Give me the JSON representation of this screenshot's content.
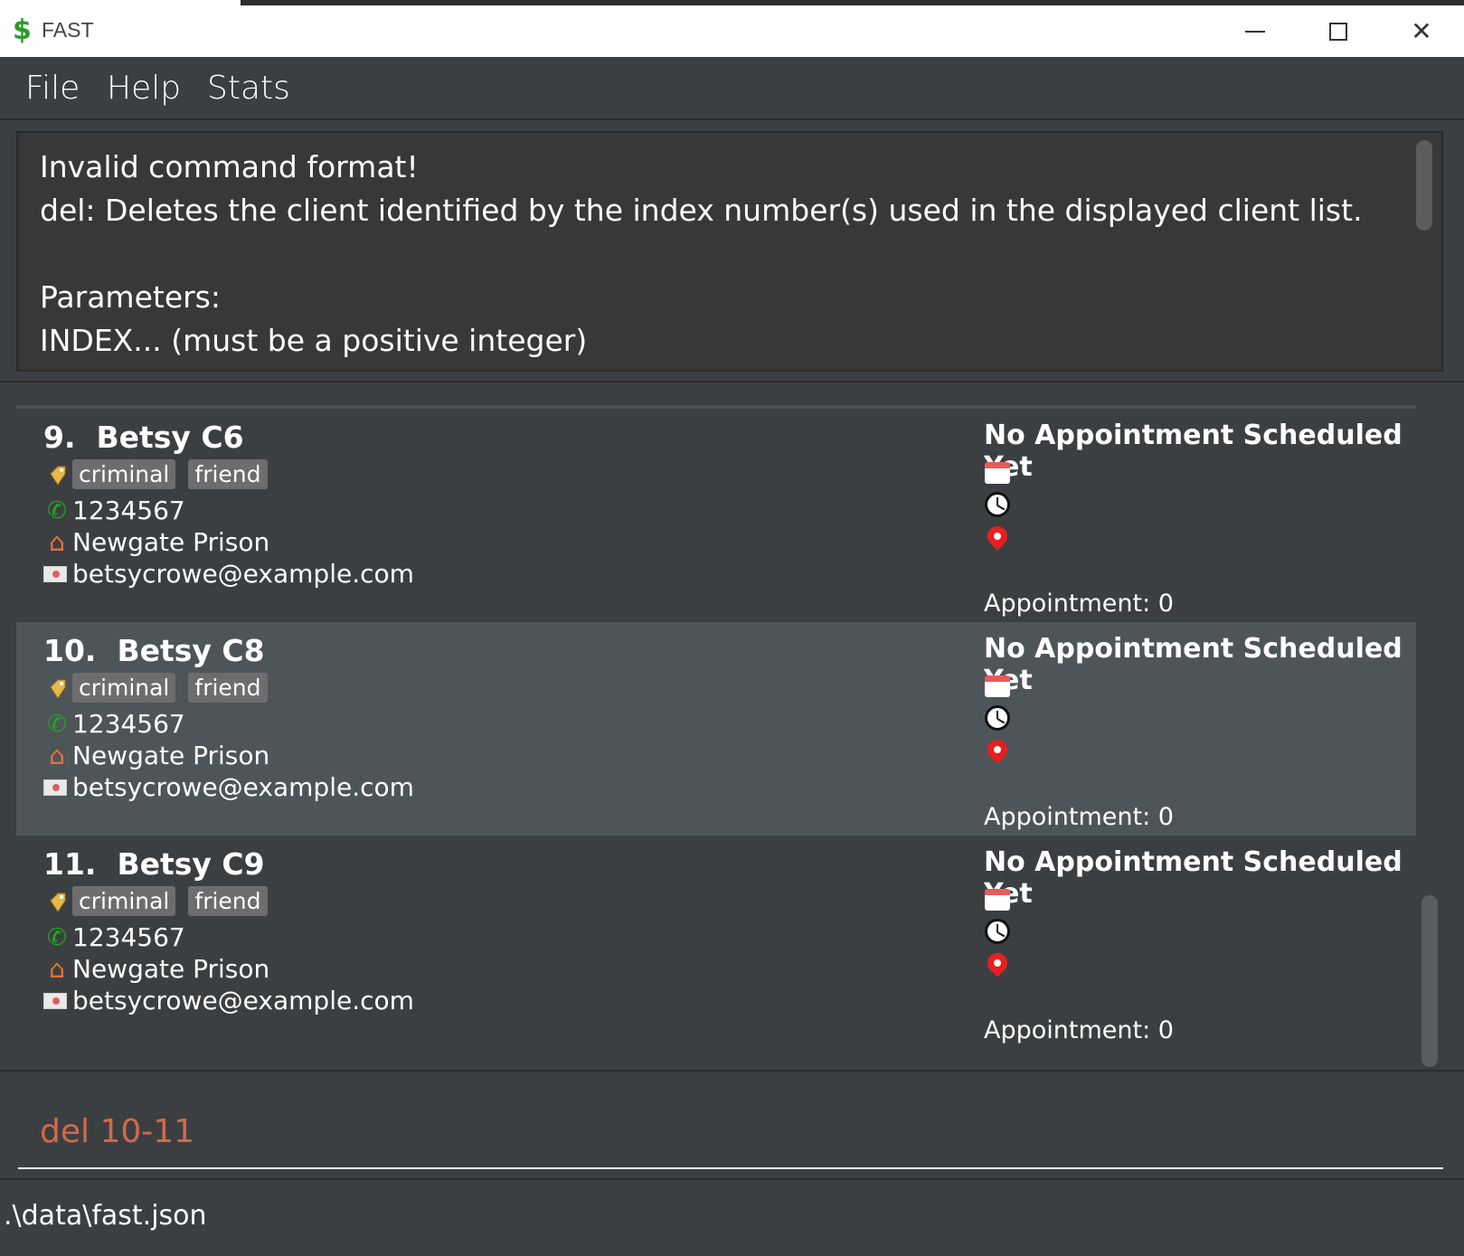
{
  "window": {
    "title": "FAST",
    "icon": "dollar-icon"
  },
  "menu": {
    "items": [
      "File",
      "Help",
      "Stats"
    ]
  },
  "result": {
    "lines": [
      "Invalid command format!",
      "del: Deletes the client identified by the index number(s) used in the displayed client list.",
      "",
      "Parameters:",
      "INDEX... (must be a positive integer)"
    ]
  },
  "clients": [
    {
      "index": "9.",
      "name": "Betsy C6",
      "tags": [
        "criminal",
        "friend"
      ],
      "phone": "1234567",
      "address": "Newgate Prison",
      "email": "betsycrowe@example.com",
      "appointment_title": "No Appointment Scheduled Yet",
      "appointment_count": "Appointment: 0",
      "selected": false
    },
    {
      "index": "10.",
      "name": "Betsy C8",
      "tags": [
        "criminal",
        "friend"
      ],
      "phone": "1234567",
      "address": "Newgate Prison",
      "email": "betsycrowe@example.com",
      "appointment_title": "No Appointment Scheduled Yet",
      "appointment_count": "Appointment: 0",
      "selected": true
    },
    {
      "index": "11.",
      "name": "Betsy C9",
      "tags": [
        "criminal",
        "friend"
      ],
      "phone": "1234567",
      "address": "Newgate Prison",
      "email": "betsycrowe@example.com",
      "appointment_title": "No Appointment Scheduled Yet",
      "appointment_count": "Appointment: 0",
      "selected": false
    }
  ],
  "command": {
    "value": "del 10-11"
  },
  "status": {
    "file_path": ".\\data\\fast.json"
  },
  "colors": {
    "background": "#3c3f41",
    "selected_card": "#4e5559",
    "tag": "#6d6d6d",
    "command_text": "#d06a4a",
    "phone_icon": "#23a723",
    "pin_icon": "#e62020"
  }
}
